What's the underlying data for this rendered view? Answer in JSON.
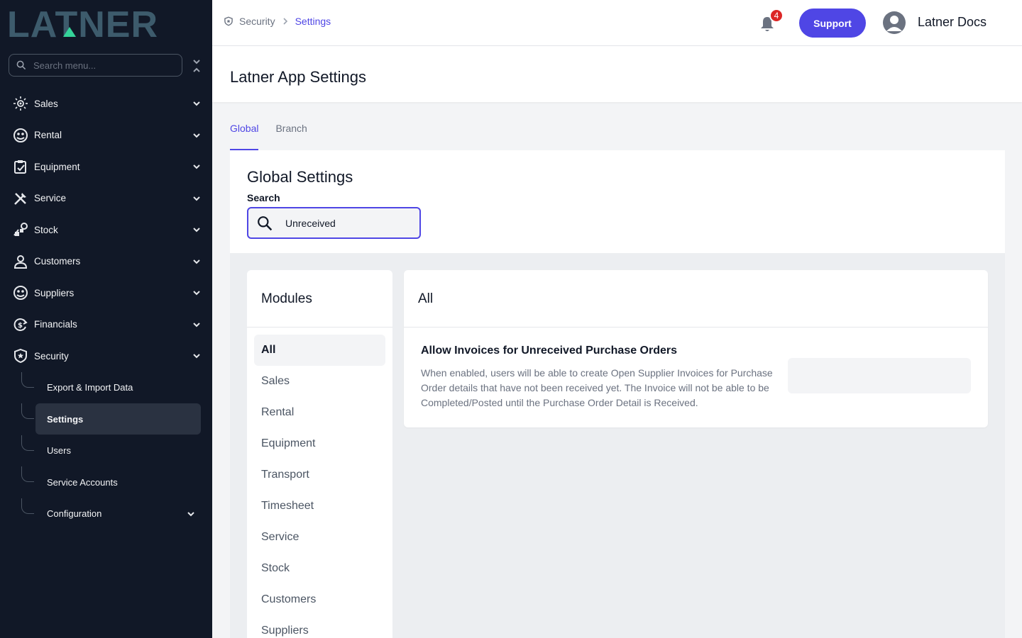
{
  "brand": {
    "logo_text": "LATNER",
    "colors": {
      "sidebar_bg": "#111827",
      "accent": "#4f46e5",
      "logo": "#3b5a6a",
      "logo_accent": "#34d399",
      "badge": "#dc2626"
    }
  },
  "sidebar": {
    "search_placeholder": "Search menu...",
    "items": [
      {
        "label": "Sales",
        "icon": "sales-icon"
      },
      {
        "label": "Rental",
        "icon": "rental-icon"
      },
      {
        "label": "Equipment",
        "icon": "equipment-icon"
      },
      {
        "label": "Service",
        "icon": "service-icon"
      },
      {
        "label": "Stock",
        "icon": "stock-icon"
      },
      {
        "label": "Customers",
        "icon": "customers-icon"
      },
      {
        "label": "Suppliers",
        "icon": "suppliers-icon"
      },
      {
        "label": "Financials",
        "icon": "financials-icon"
      },
      {
        "label": "Security",
        "icon": "shield-icon"
      }
    ],
    "security_sub": [
      {
        "label": "Export & Import Data"
      },
      {
        "label": "Settings"
      },
      {
        "label": "Users"
      },
      {
        "label": "Service Accounts"
      },
      {
        "label": "Configuration"
      }
    ]
  },
  "header": {
    "breadcrumb": {
      "parent": "Security",
      "current": "Settings"
    },
    "notification_count": "4",
    "support_label": "Support",
    "user_name": "Latner Docs"
  },
  "page": {
    "title": "Latner App Settings",
    "tabs": [
      {
        "label": "Global"
      },
      {
        "label": "Branch"
      }
    ],
    "global": {
      "title": "Global Settings",
      "search_label": "Search",
      "search_value": "Unreceived"
    },
    "modules": {
      "title": "Modules",
      "items": [
        {
          "label": "All"
        },
        {
          "label": "Sales"
        },
        {
          "label": "Rental"
        },
        {
          "label": "Equipment"
        },
        {
          "label": "Transport"
        },
        {
          "label": "Timesheet"
        },
        {
          "label": "Service"
        },
        {
          "label": "Stock"
        },
        {
          "label": "Customers"
        },
        {
          "label": "Suppliers"
        }
      ]
    },
    "panel": {
      "title": "All",
      "setting": {
        "name": "Allow Invoices for Unreceived Purchase Orders",
        "description": "When enabled, users will be able to create Open Supplier Invoices for Purchase Order details that have not been received yet. The Invoice will not be able to be Completed/Posted until the Purchase Order Detail is Received."
      }
    }
  }
}
